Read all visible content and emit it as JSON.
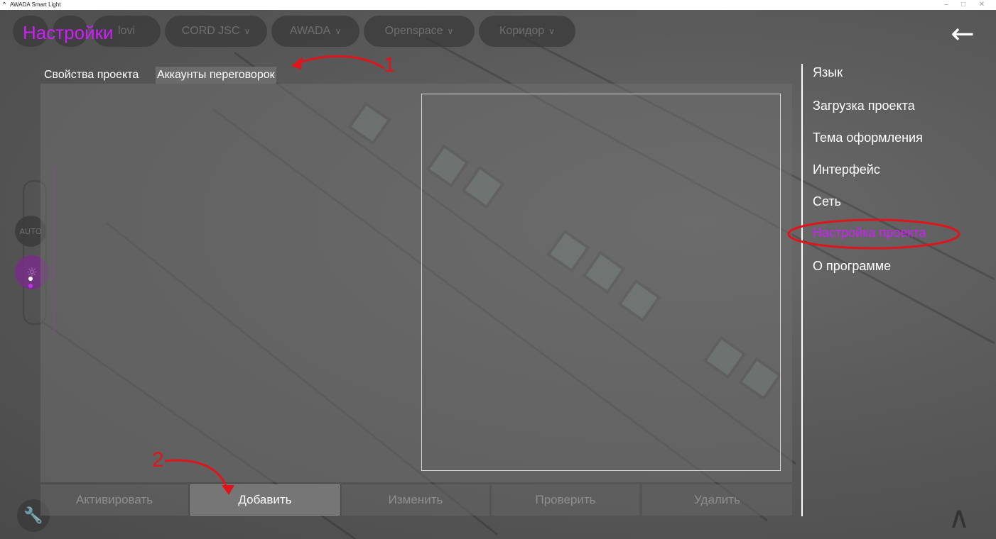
{
  "window": {
    "title": "AWADA Smart Light",
    "logo": "^",
    "minimize": "–",
    "maximize": "□",
    "close": "✕"
  },
  "header": {
    "title": "Настройки",
    "back_icon": "arrow-left-icon",
    "back_glyph": "←",
    "background_pills": [
      {
        "label": "lovi"
      },
      {
        "label": "CORD JSC"
      },
      {
        "label": "AWADA"
      },
      {
        "label": "Openspace"
      },
      {
        "label": "Коридор"
      }
    ]
  },
  "tabs": [
    {
      "label": "Свойства проекта",
      "active": false
    },
    {
      "label": "Аккаунты переговорок",
      "active": true
    }
  ],
  "actions": {
    "activate": "Активировать",
    "add": "Добавить",
    "edit": "Изменить",
    "check": "Проверить",
    "delete": "Удалить"
  },
  "menu": [
    {
      "label": "Язык",
      "active": false
    },
    {
      "label": "Загрузка проекта",
      "active": false
    },
    {
      "label": "Тема оформления",
      "active": false
    },
    {
      "label": "Интерфейс",
      "active": false
    },
    {
      "label": "Сеть",
      "active": false
    },
    {
      "label": "Настройка проекта",
      "active": true
    },
    {
      "label": "О программе",
      "active": false
    }
  ],
  "side": {
    "auto_label": "AUTO",
    "sun_glyph": "☼",
    "wrench_glyph": "🔧",
    "up_glyph": "∧"
  },
  "annotations": [
    {
      "label": "1"
    },
    {
      "label": "2"
    }
  ],
  "colors": {
    "accent": "#d11cff",
    "annotation": "#e0141b",
    "background": "#555555"
  }
}
